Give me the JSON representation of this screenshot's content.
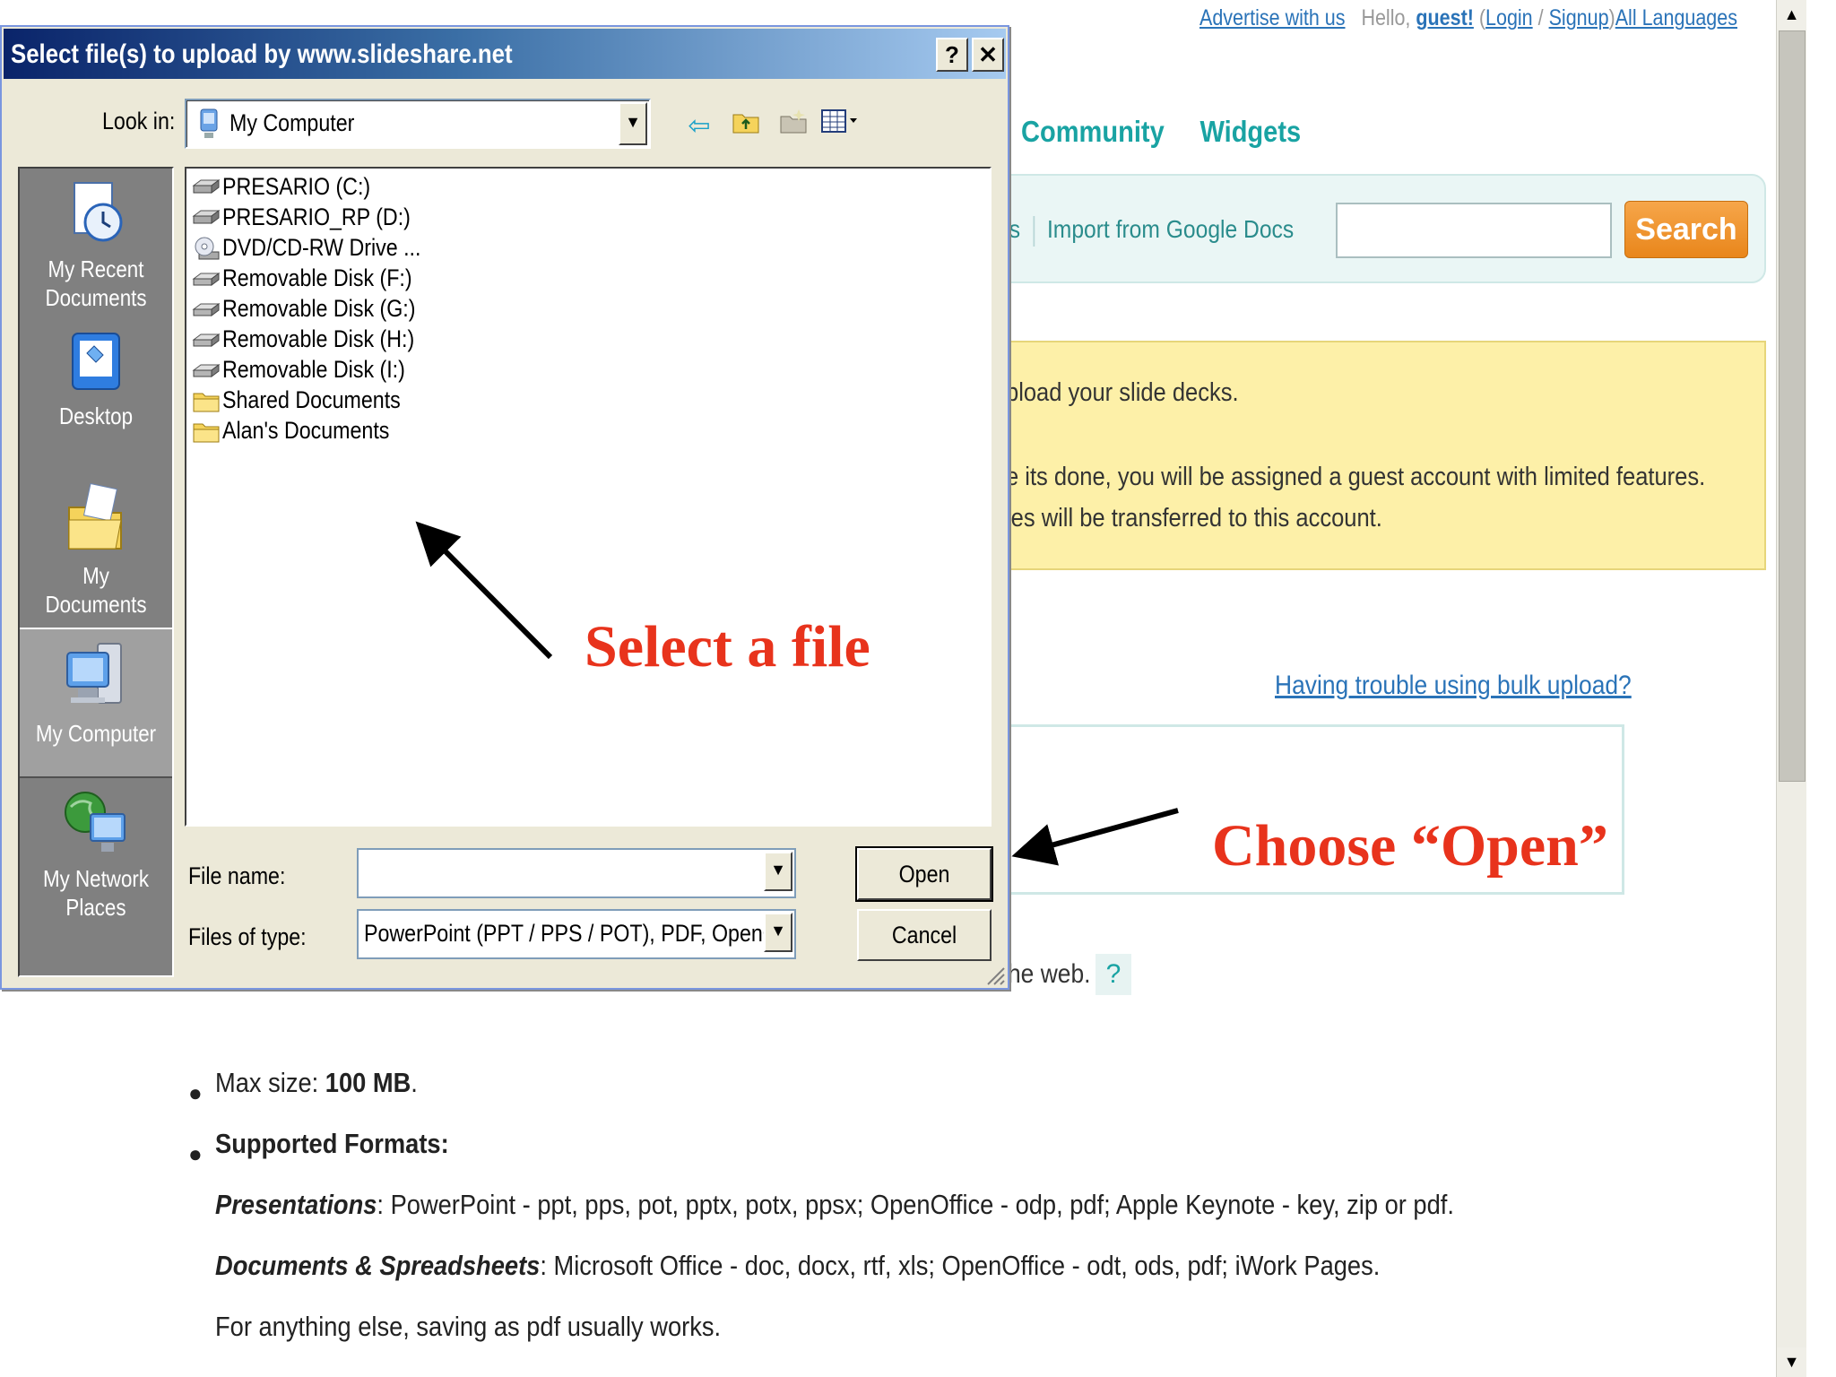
{
  "page": {
    "toplinks": {
      "advertise": "Advertise with us",
      "hello": "Hello,",
      "guest": "guest!",
      "open_paren": "(",
      "login": "Login",
      "slash": "/",
      "signup": "Signup",
      "close_paren": ")",
      "all_languages": "All Languages"
    },
    "nav": {
      "community": "Community",
      "widgets": "Widgets"
    },
    "searchbar": {
      "partial_link": "ns",
      "import_link": "Import from Google Docs",
      "search_button": "Search"
    },
    "notice": {
      "line1": "pload your slide decks.",
      "line2": "e its done, you will be assigned a guest account with limited features.",
      "line3": "les will be transferred to this account."
    },
    "trouble_link": "Having trouble using bulk upload?",
    "web_note": "he web.",
    "help_q": "?",
    "info": {
      "max_size_label": "Max size: ",
      "max_size_value": "100 MB",
      "max_size_end": ".",
      "formats_heading": "Supported Formats:",
      "presentations_label": "Presentations",
      "presentations_text": ": PowerPoint - ppt, pps, pot, pptx, potx, ppsx; OpenOffice - odp, pdf; Apple Keynote - key, zip or pdf.",
      "documents_label": "Documents & Spreadsheets",
      "documents_text": ": Microsoft Office - doc, docx, rtf, xls; OpenOffice - odt, ods, pdf; iWork Pages.",
      "anything_else": "For anything else, saving as pdf usually works."
    }
  },
  "dialog": {
    "title": "Select file(s) to upload by www.slideshare.net",
    "help_btn": "?",
    "close_btn": "✕",
    "look_in_label": "Look in:",
    "look_in_value": "My Computer",
    "places": [
      {
        "label": "My Recent Documents",
        "icon": "recent-documents-icon"
      },
      {
        "label": "Desktop",
        "icon": "desktop-icon"
      },
      {
        "label": "My Documents",
        "icon": "my-documents-icon"
      },
      {
        "label": "My Computer",
        "icon": "my-computer-icon"
      },
      {
        "label": "My Network Places",
        "icon": "network-places-icon"
      }
    ],
    "files": [
      {
        "name": "PRESARIO (C:)",
        "icon": "hard-drive-icon"
      },
      {
        "name": "PRESARIO_RP (D:)",
        "icon": "hard-drive-icon"
      },
      {
        "name": "DVD/CD-RW Drive ...",
        "icon": "cd-drive-icon"
      },
      {
        "name": "Removable Disk (F:)",
        "icon": "removable-disk-icon"
      },
      {
        "name": "Removable Disk (G:)",
        "icon": "removable-disk-icon"
      },
      {
        "name": "Removable Disk (H:)",
        "icon": "removable-disk-icon"
      },
      {
        "name": "Removable Disk (I:)",
        "icon": "removable-disk-icon"
      },
      {
        "name": "Shared Documents",
        "icon": "folder-icon"
      },
      {
        "name": "Alan's Documents",
        "icon": "folder-icon"
      }
    ],
    "file_name_label": "File name:",
    "file_name_value": "",
    "files_of_type_label": "Files of type:",
    "files_of_type_value": "PowerPoint (PPT / PPS / POT), PDF, OpenOff",
    "open_button": "Open",
    "cancel_button": "Cancel"
  },
  "annotations": {
    "select_file": "Select a file",
    "choose_open": "Choose “Open”"
  },
  "colors": {
    "annotation_red": "#e8331c",
    "titlebar_blue": "#0a246a",
    "search_orange": "#e9861b",
    "nav_teal": "#19a3a3",
    "notice_yellow": "#fdf0a8"
  }
}
